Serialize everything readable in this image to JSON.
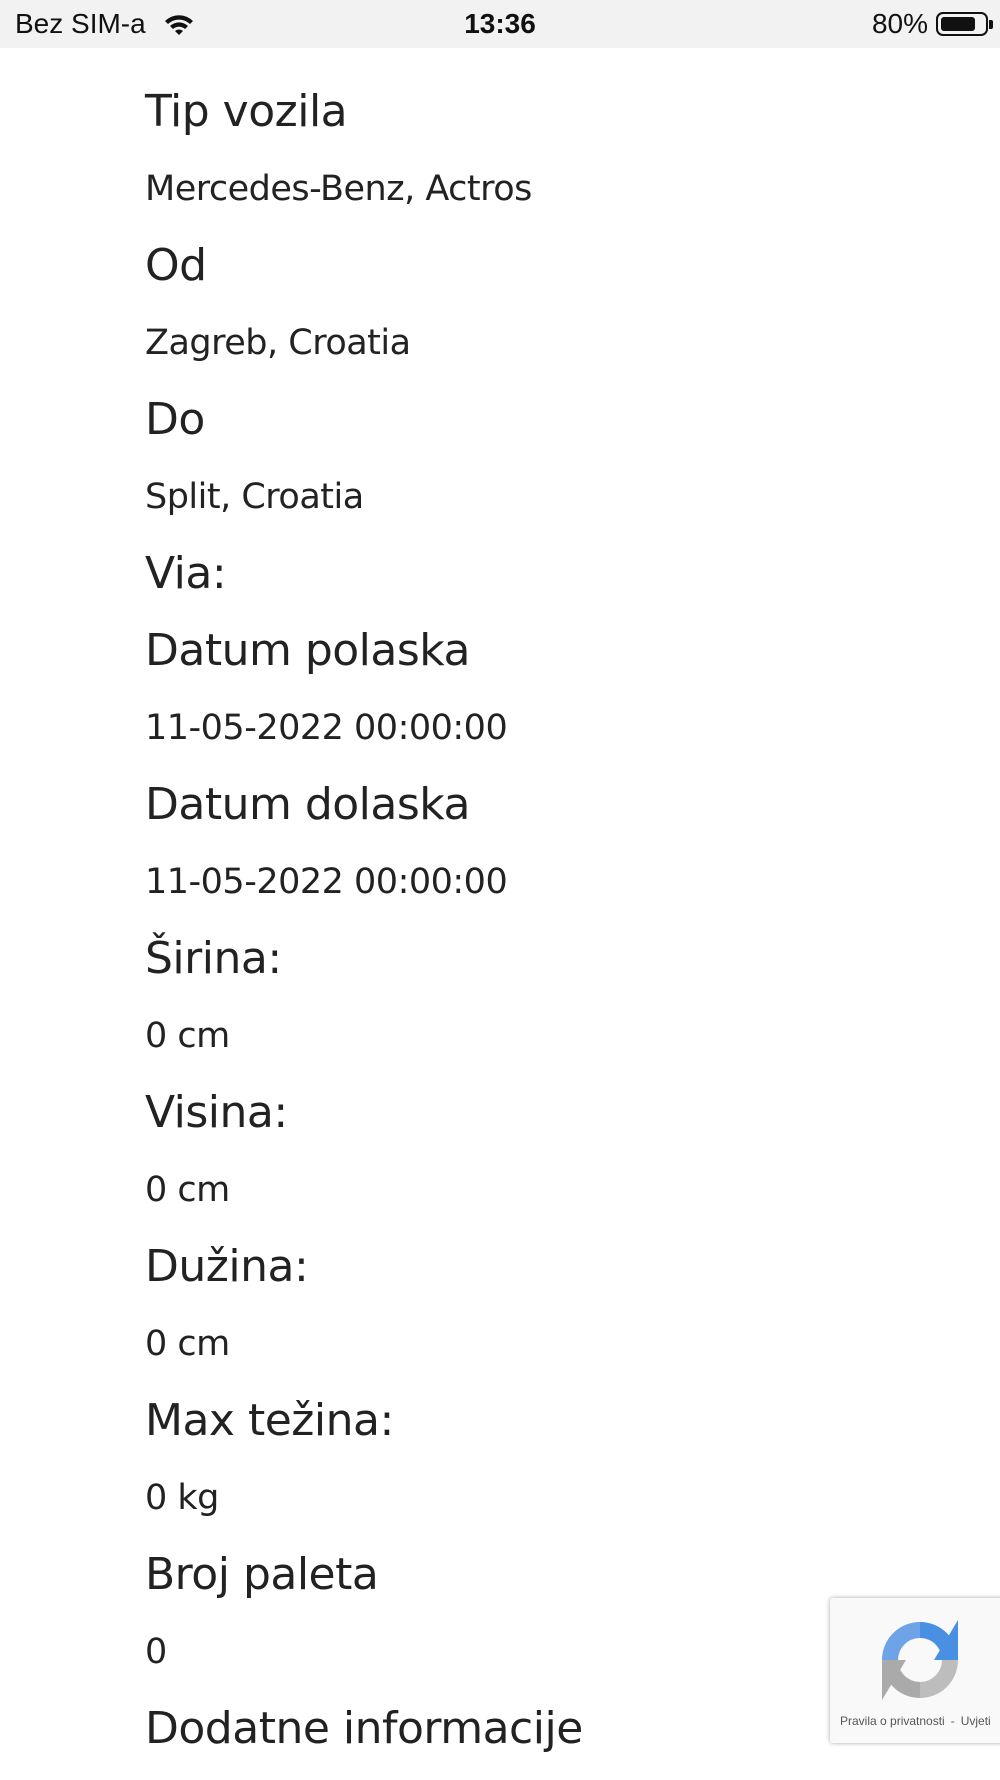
{
  "status_bar": {
    "carrier": "Bez SIM-a",
    "time": "13:36",
    "battery_percent": "80%",
    "battery_level": 0.8
  },
  "details": [
    {
      "label": "Tip vozila",
      "value": "Mercedes-Benz, Actros"
    },
    {
      "label": "Od",
      "value": "Zagreb, Croatia"
    },
    {
      "label": "Do",
      "value": "Split, Croatia"
    },
    {
      "label": "Via:",
      "value": ""
    },
    {
      "label": "Datum polaska",
      "value": "11-05-2022 00:00:00"
    },
    {
      "label": "Datum dolaska",
      "value": "11-05-2022 00:00:00"
    },
    {
      "label": "Širina:",
      "value": "0 cm"
    },
    {
      "label": "Visina:",
      "value": "0 cm"
    },
    {
      "label": "Dužina:",
      "value": "0 cm"
    },
    {
      "label": "Max težina:",
      "value": "0 kg"
    },
    {
      "label": "Broj paleta",
      "value": "0"
    },
    {
      "label": "Dodatne informacije",
      "value": ""
    }
  ],
  "recaptcha": {
    "privacy_label": "Pravila o privatnosti",
    "separator": "-",
    "terms_label": "Uvjeti"
  },
  "colors": {
    "text": "#222222",
    "status_bar_bg": "#f2f2f2",
    "recaptcha_blue": "#4a90e2",
    "recaptcha_gray": "#aaaaaa"
  },
  "icons": [
    "wifi-icon",
    "battery-icon",
    "recaptcha-logo-icon"
  ]
}
